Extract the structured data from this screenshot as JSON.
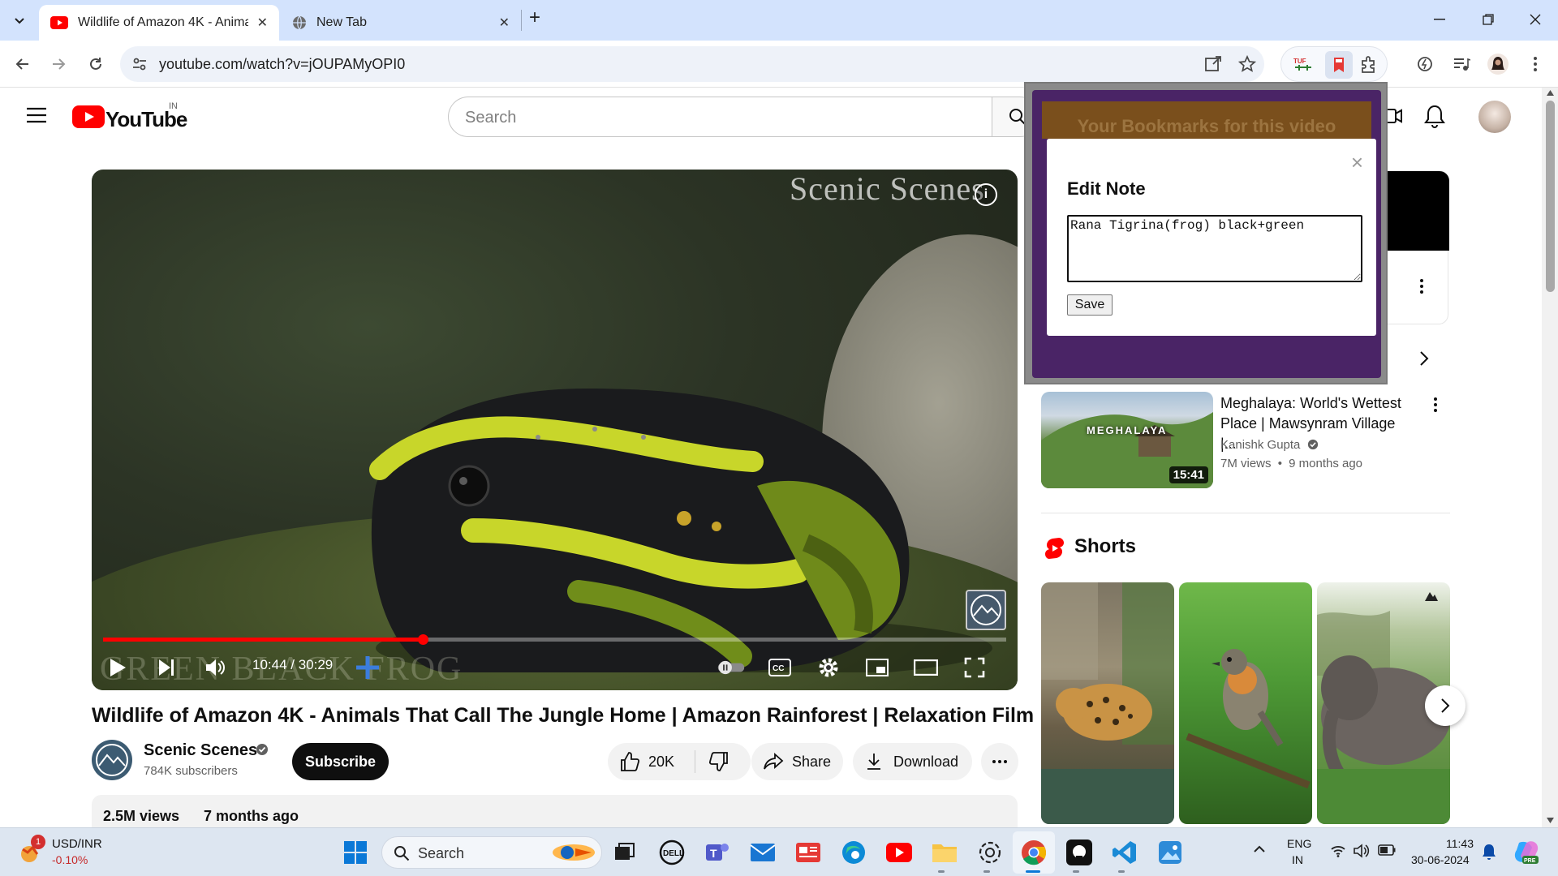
{
  "browser": {
    "tabs": [
      {
        "title": "Wildlife of Amazon 4K - Animals That Call The Jungle Home",
        "close": "✕"
      },
      {
        "title": "New Tab",
        "close": "✕"
      }
    ],
    "new_tab": "+",
    "url": "youtube.com/watch?v=jOUPAMyOPI0"
  },
  "youtube": {
    "logo_text": "YouTube",
    "country": "IN",
    "search_placeholder": "Search"
  },
  "video": {
    "watermark": "Scenic Scenes",
    "caption_overlay": "GREEN BLACK FROG",
    "time": "10:44 / 30:29",
    "progress": 0.354,
    "title": "Wildlife of Amazon 4K - Animals That Call The Jungle Home | Amazon Rainforest | Relaxation Film",
    "channel": "Scenic Scenes",
    "subscribers": "784K subscribers",
    "subscribe_label": "Subscribe",
    "likes": "20K",
    "share_label": "Share",
    "download_label": "Download",
    "views": "2.5M views",
    "age": "7 months ago"
  },
  "sidebar": {
    "recommended": {
      "title": "Meghalaya: World's Wettest Place | Mawsynram Village |...",
      "thumb_label": "MEGHALAYA",
      "channel": "Kanishk Gupta",
      "views": "7M views",
      "age": "9 months ago",
      "duration": "15:41"
    },
    "shorts_title": "Shorts"
  },
  "extension": {
    "header": "Your Bookmarks for this video",
    "modal_title": "Edit Note",
    "close": "×",
    "note": "Rana Tigrina(frog) black+green",
    "save_label": "Save"
  },
  "taskbar": {
    "ticker": "USD/INR",
    "ticker_change": "-0.10%",
    "ticker_badge": "1",
    "search": "Search",
    "lang": "ENG",
    "region": "IN",
    "time": "11:43",
    "date": "30-06-2024"
  },
  "colors": {
    "youtube_red": "#ff0000",
    "popup_purple": "#4a2466",
    "chrome_tabstrip": "#d3e3fd"
  }
}
